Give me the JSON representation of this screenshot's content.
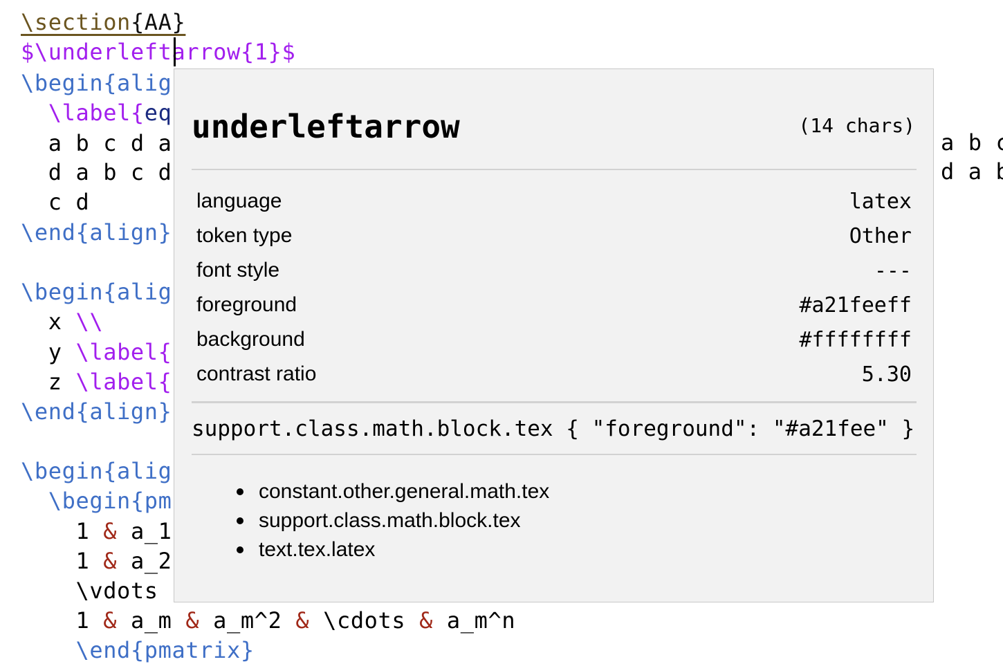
{
  "editor": {
    "lines": [
      [
        {
          "t": "\\section",
          "c": "c-section"
        },
        {
          "t": "{AA}",
          "c": "c-secarg"
        }
      ],
      [
        {
          "t": "$\\underleftarrow{1}$",
          "c": "c-math"
        }
      ],
      [
        {
          "t": "\\begin{alig",
          "c": "c-kw"
        }
      ],
      [
        {
          "t": "  ",
          "c": ""
        },
        {
          "t": "\\label{",
          "c": "c-label"
        },
        {
          "t": "eq",
          "c": "c-eq"
        }
      ],
      [
        {
          "t": "  a b c d a",
          "c": ""
        }
      ],
      [
        {
          "t": "  d a b c d",
          "c": ""
        }
      ],
      [
        {
          "t": "  c d",
          "c": ""
        }
      ],
      [
        {
          "t": "\\end{align}",
          "c": "c-kw"
        }
      ],
      [
        {
          "t": "",
          "c": ""
        }
      ],
      [
        {
          "t": "\\begin{alig",
          "c": "c-kw"
        }
      ],
      [
        {
          "t": "  x ",
          "c": ""
        },
        {
          "t": "\\\\",
          "c": "c-math"
        }
      ],
      [
        {
          "t": "  y ",
          "c": ""
        },
        {
          "t": "\\label{",
          "c": "c-label"
        }
      ],
      [
        {
          "t": "  z ",
          "c": ""
        },
        {
          "t": "\\label{",
          "c": "c-label"
        }
      ],
      [
        {
          "t": "\\end{align}",
          "c": "c-kw"
        }
      ],
      [
        {
          "t": "",
          "c": ""
        }
      ],
      [
        {
          "t": "\\begin{alig",
          "c": "c-kw"
        }
      ],
      [
        {
          "t": "  ",
          "c": ""
        },
        {
          "t": "\\begin{pm",
          "c": "c-kw"
        }
      ],
      [
        {
          "t": "    1 ",
          "c": ""
        },
        {
          "t": "&",
          "c": "c-amp"
        },
        {
          "t": " a_1",
          "c": ""
        }
      ],
      [
        {
          "t": "    1 ",
          "c": ""
        },
        {
          "t": "&",
          "c": "c-amp"
        },
        {
          "t": " a_2",
          "c": ""
        }
      ],
      [
        {
          "t": "    \\vdots",
          "c": ""
        }
      ],
      [
        {
          "t": "    1 ",
          "c": ""
        },
        {
          "t": "&",
          "c": "c-amp"
        },
        {
          "t": " a_m ",
          "c": ""
        },
        {
          "t": "&",
          "c": "c-amp"
        },
        {
          "t": " a_m^2 ",
          "c": ""
        },
        {
          "t": "&",
          "c": "c-amp"
        },
        {
          "t": " \\cdots ",
          "c": ""
        },
        {
          "t": "&",
          "c": "c-amp"
        },
        {
          "t": " a_m^n",
          "c": ""
        }
      ],
      [
        {
          "t": "    \\end{pmatrix}",
          "c": "c-kw"
        }
      ]
    ],
    "right_overflow": [
      "a b c",
      "d a b"
    ]
  },
  "tooltip": {
    "title": "underleftarrow",
    "chars": "(14 chars)",
    "properties": [
      {
        "key": "language",
        "value": "latex"
      },
      {
        "key": "token type",
        "value": "Other"
      },
      {
        "key": "font style",
        "value": "---"
      },
      {
        "key": "foreground",
        "value": "#a21feeff"
      },
      {
        "key": "background",
        "value": "#ffffffff"
      },
      {
        "key": "contrast ratio",
        "value": "5.30"
      }
    ],
    "rule": "support.class.math.block.tex { \"foreground\": \"#a21fee\" }",
    "scopes": [
      "constant.other.general.math.tex",
      "support.class.math.block.tex",
      "text.tex.latex"
    ]
  },
  "colors": {
    "math": "#a21fee",
    "keyword": "#3f6fc6",
    "section": "#6b5520",
    "ampersand": "#a02818",
    "tooltip_bg": "#f2f2f2"
  }
}
